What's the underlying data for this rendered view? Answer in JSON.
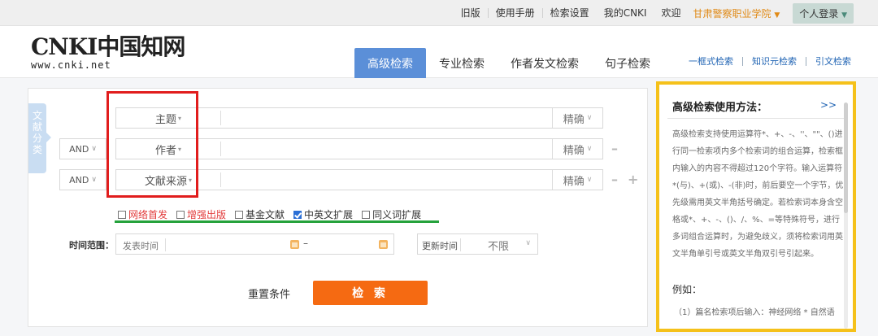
{
  "topbar": {
    "links": [
      "旧版",
      "使用手册",
      "检索设置",
      "我的CNKI",
      "欢迎"
    ],
    "school": "甘肃警察职业学院",
    "login": "个人登录"
  },
  "header": {
    "brand": "CNKI中国知网",
    "url": "www.cnki.net",
    "tabs": [
      "高级检索",
      "专业检索",
      "作者发文检索",
      "句子检索"
    ],
    "right_links": [
      "一框式检索",
      "知识元检索",
      "引文检索"
    ]
  },
  "side_tab": [
    "文",
    "献",
    "分",
    "类"
  ],
  "rows": [
    {
      "op": "",
      "field": "主题",
      "exact": "精确"
    },
    {
      "op": "AND",
      "field": "作者",
      "exact": "精确"
    },
    {
      "op": "AND",
      "field": "文献来源",
      "exact": "精确"
    }
  ],
  "checks": [
    {
      "label": "网络首发",
      "checked": false,
      "red": true
    },
    {
      "label": "增强出版",
      "checked": false,
      "red": true
    },
    {
      "label": "基金文献",
      "checked": false,
      "red": false
    },
    {
      "label": "中英文扩展",
      "checked": true,
      "red": false
    },
    {
      "label": "同义词扩展",
      "checked": false,
      "red": false
    }
  ],
  "time": {
    "label": "时间范围：",
    "placeholder": "发表时间",
    "dash": "–",
    "update_label": "更新时间",
    "update_value": "不限"
  },
  "actions": {
    "reset": "重置条件",
    "search": "检 索"
  },
  "help": {
    "title": "高级检索使用方法：",
    "more": ">>",
    "text": "高级检索支持使用运算符*、+、-、''、\"\"、()进行同一检索项内多个检索词的组合运算，检索框内输入的内容不得超过120个字符。输入运算符*(与)、+(或)、-(非)时，前后要空一个字节，优先级需用英文半角括号确定。若检索词本身含空格或*、+、-、()、/、%、=等特殊符号，进行多词组合运算时，为避免歧义，须将检索词用英文半角单引号或英文半角双引号引起来。",
    "example_title": "例如：",
    "example_line": "（1）篇名检索项后输入：神经网络 * 自然语"
  }
}
